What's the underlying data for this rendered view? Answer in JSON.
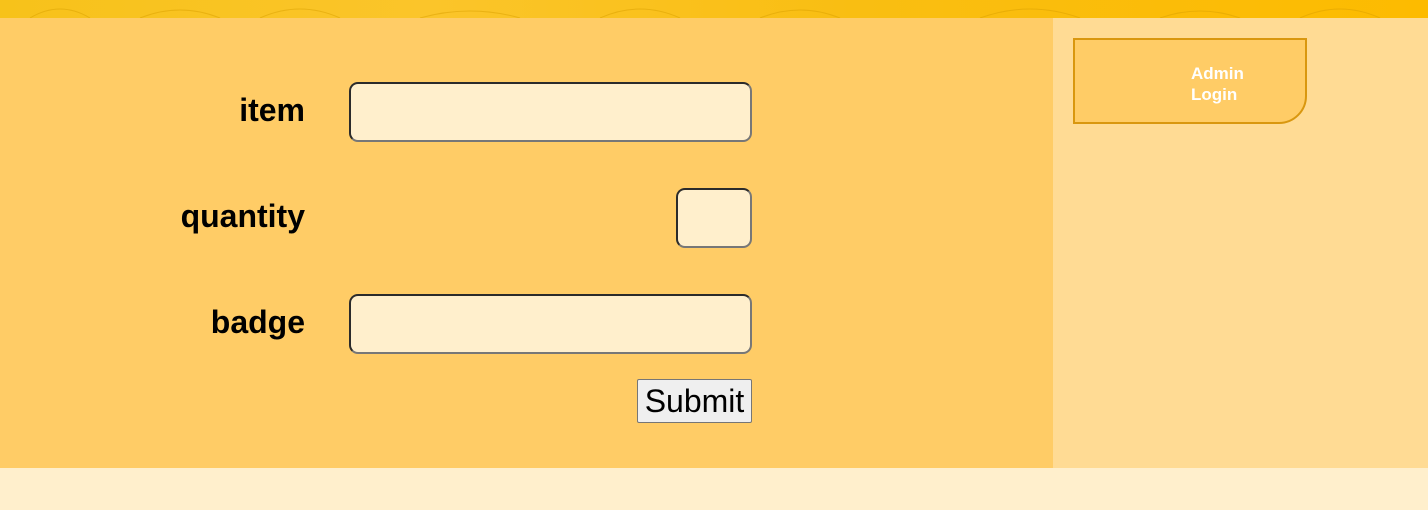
{
  "form": {
    "fields": [
      {
        "label": "item",
        "value": "",
        "placeholder": ""
      },
      {
        "label": "quantity",
        "value": "",
        "placeholder": ""
      },
      {
        "label": "badge",
        "value": "",
        "placeholder": ""
      }
    ],
    "submit_label": "Submit"
  },
  "sidebar": {
    "admin_login_label": "Admin Login"
  },
  "colors": {
    "main_bg": "#ffcc66",
    "side_bg": "#ffdb94",
    "footer_bg": "#ffefcc",
    "banner": "#fbc52a",
    "admin_border": "#d9970f"
  }
}
